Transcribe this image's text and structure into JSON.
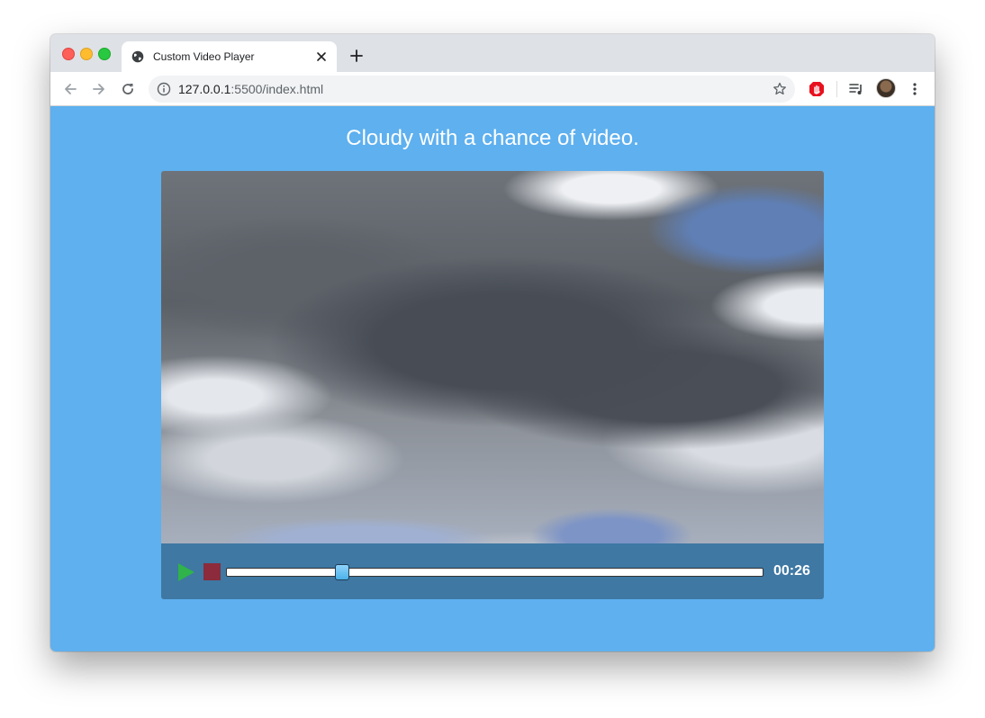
{
  "browser": {
    "tab_title": "Custom Video Player",
    "url_host": "127.0.0.1",
    "url_rest": ":5500/index.html"
  },
  "page": {
    "heading": "Cloudy with a chance of video."
  },
  "player": {
    "timestamp": "00:26",
    "progress_fraction": 0.215,
    "colors": {
      "play": "#2fb34a",
      "stop": "#8b2b3b",
      "controls_bg": "#3e78a3",
      "page_bg": "#5eb0ef"
    }
  },
  "icons": {
    "tab": "globe-icon",
    "tab_close": "close-icon",
    "new_tab": "plus-icon",
    "back": "back-arrow-icon",
    "forward": "forward-arrow-icon",
    "reload": "reload-icon",
    "site_info": "info-icon",
    "bookmark": "star-icon",
    "extension": "adblock-icon",
    "media": "media-queue-icon",
    "profile": "avatar",
    "menu": "kebab-menu-icon"
  }
}
